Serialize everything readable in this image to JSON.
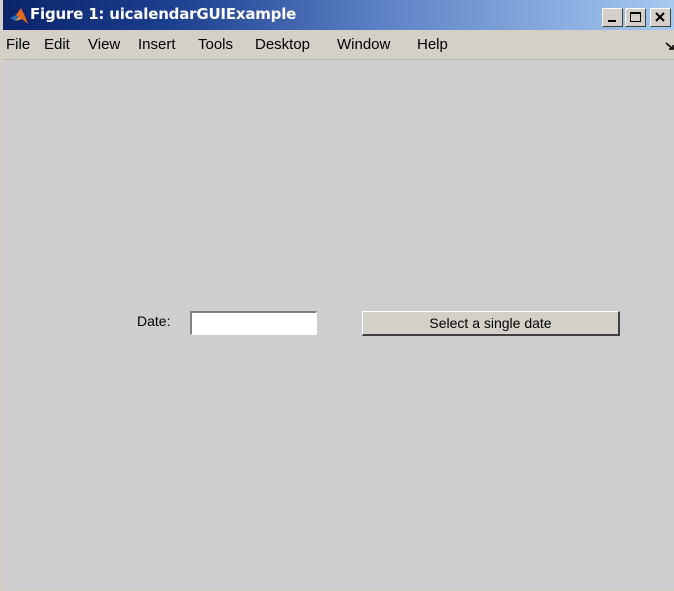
{
  "window": {
    "title": "Figure 1: uicalendarGUIExample",
    "icon": "matlab-logo-icon",
    "controls": {
      "minimize_icon": "minimize-icon",
      "maximize_icon": "maximize-icon",
      "close_icon": "close-icon"
    },
    "colors": {
      "titlebar_start": "#0a246a",
      "titlebar_end": "#a6caf0",
      "background": "#cecece",
      "chrome": "#d4d0c8"
    }
  },
  "menubar": {
    "items": [
      "File",
      "Edit",
      "View",
      "Insert",
      "Tools",
      "Desktop",
      "Window",
      "Help"
    ],
    "dock_icon": "dock-arrow-icon"
  },
  "form": {
    "date_label": "Date:",
    "date_value": "",
    "select_button_label": "Select a single date"
  }
}
